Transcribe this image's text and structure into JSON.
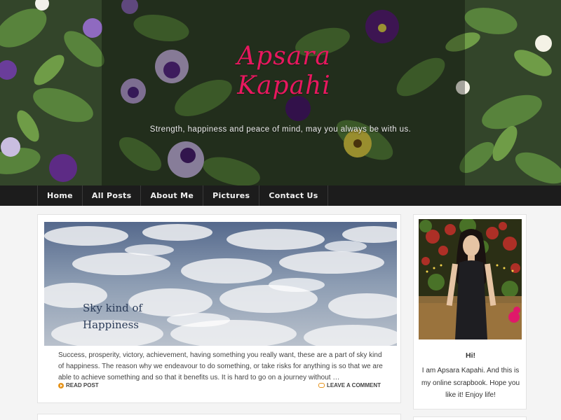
{
  "header": {
    "title_line1": "Apsara",
    "title_line2": "Kapahi",
    "tagline": "Strength, happiness and peace of mind, may you always be with us."
  },
  "nav": {
    "items": [
      "Home",
      "All Posts",
      "About Me",
      "Pictures",
      "Contact Us"
    ]
  },
  "post": {
    "image_caption_line1": "Sky kind of",
    "image_caption_line2": "Happiness",
    "excerpt": "Success, prosperity, victory, achievement, having something you really want, these are a part of sky kind of happiness. The reason why we endeavour to do something, or take risks for anything is so that we are able to achieve something and so that it benefits us. It is hard to go on a journey without …",
    "read_label": "READ POST",
    "comment_label": "LEAVE A COMMENT"
  },
  "sidebar": {
    "greeting": "Hi!",
    "bio": "I am Apsara Kapahi. And this is my online scrapbook. Hope you like it! Enjoy life!"
  },
  "colors": {
    "title": "#e8185f",
    "nav_bg": "#1c1c1c",
    "accent": "#e6941c"
  }
}
